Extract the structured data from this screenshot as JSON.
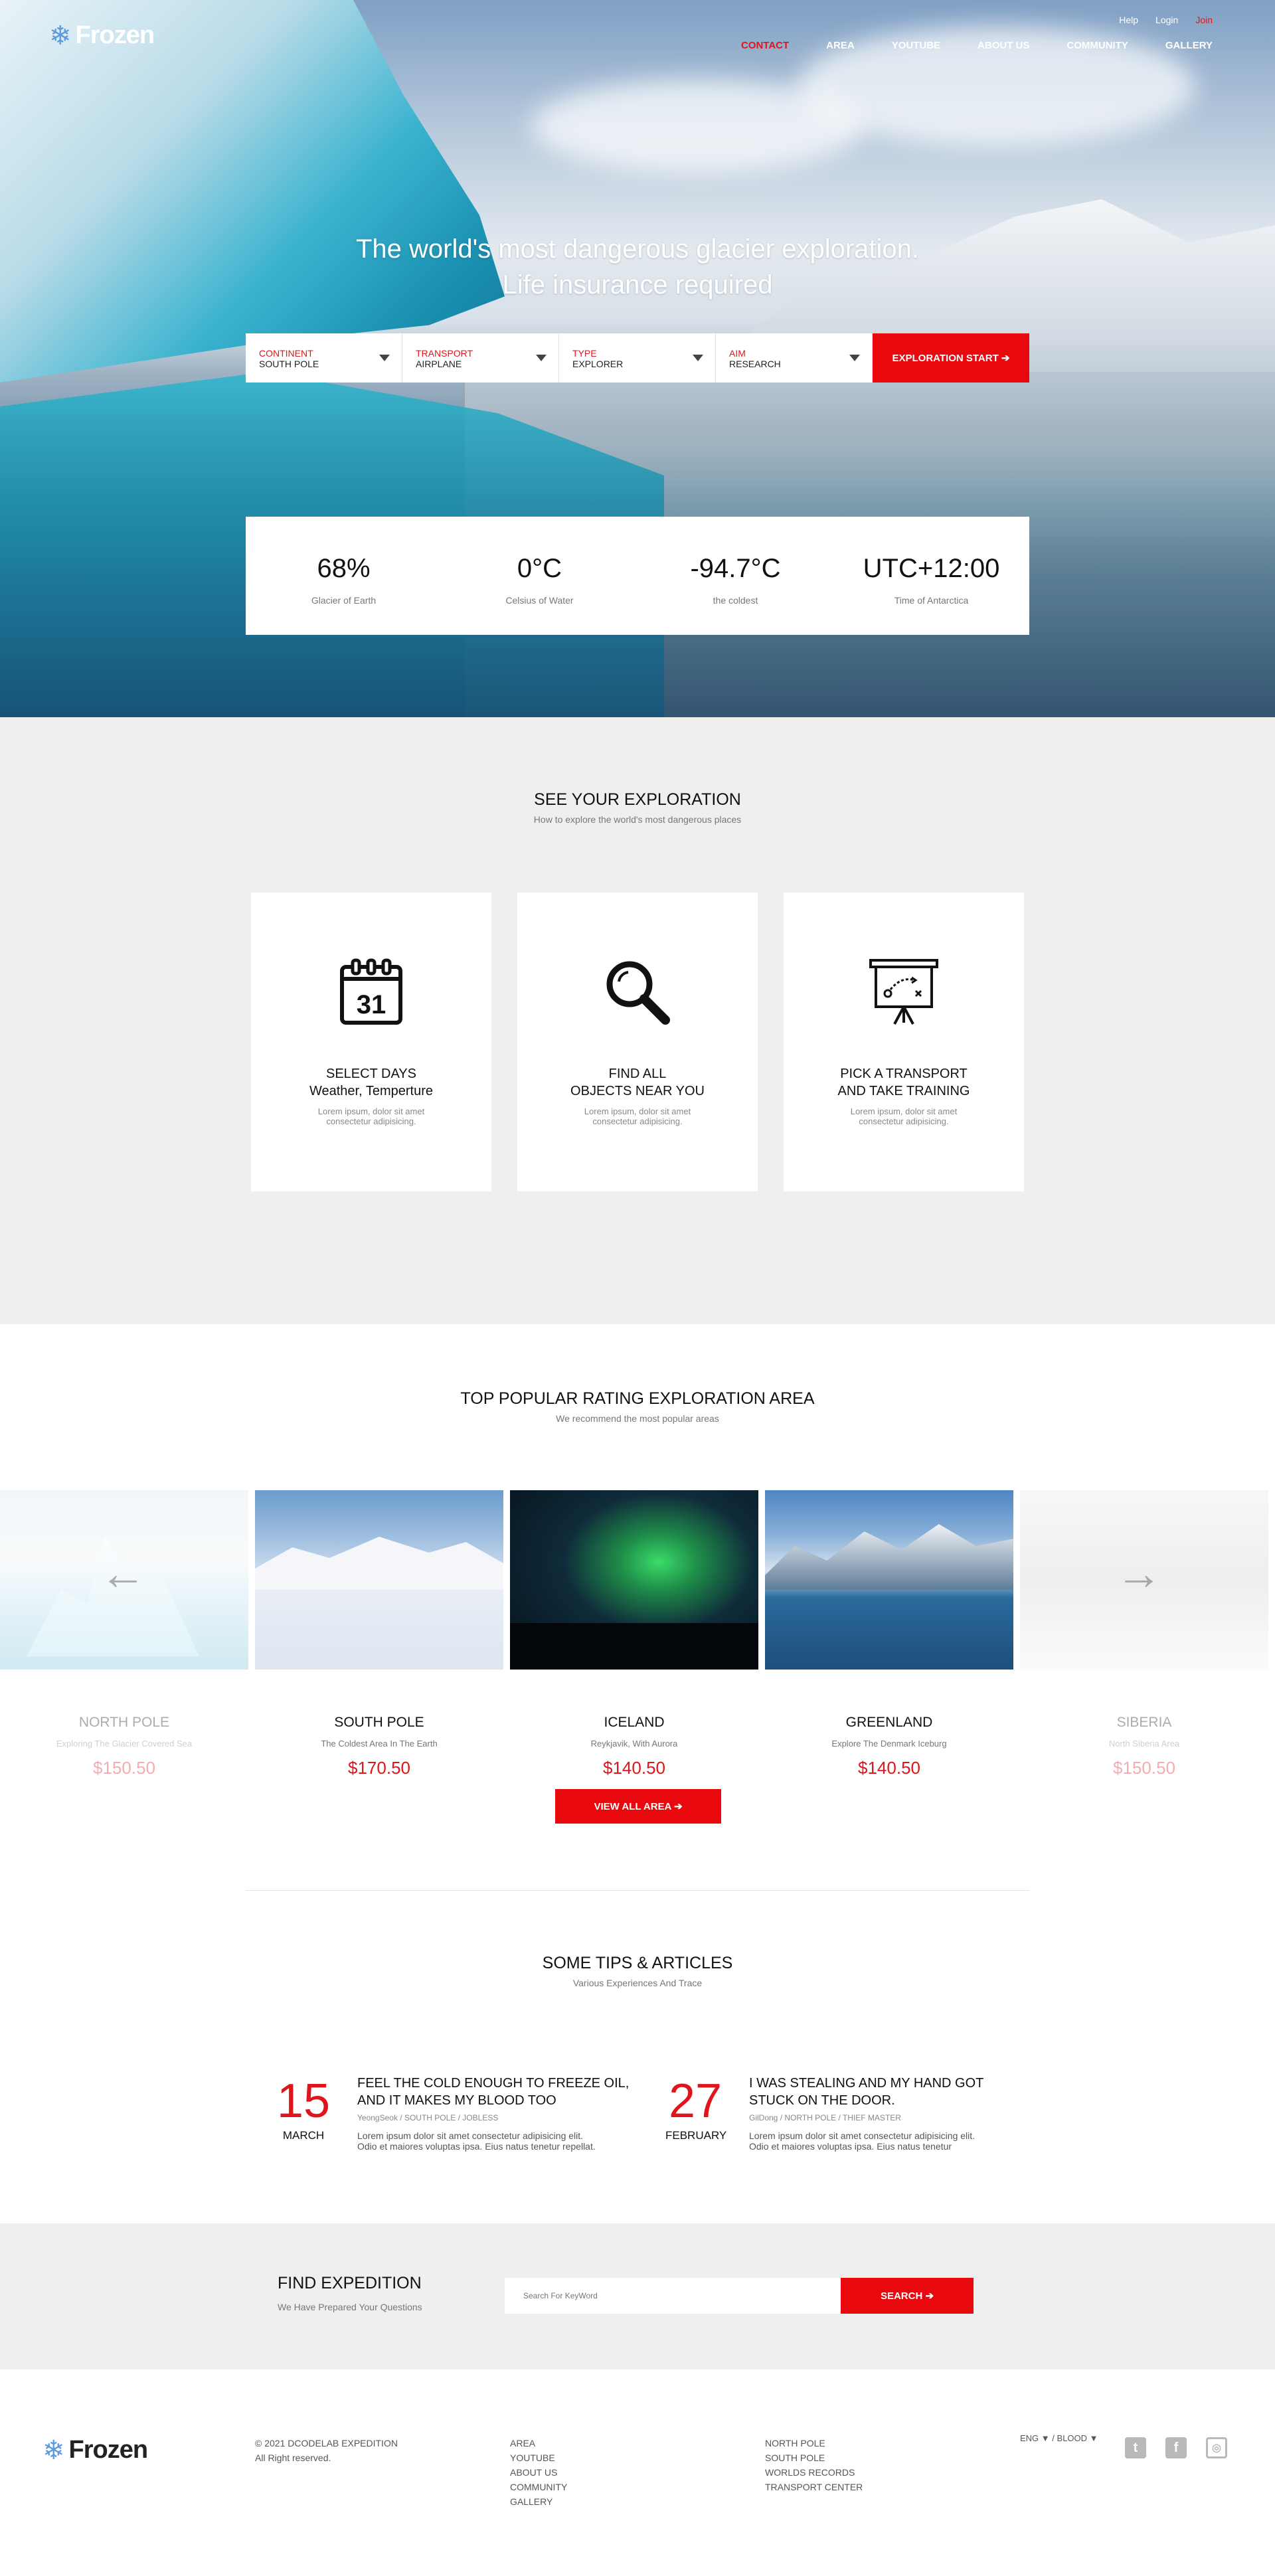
{
  "brand": {
    "name": "Frozen"
  },
  "header": {
    "top_links": [
      "Help",
      "Login",
      "Join"
    ],
    "nav": [
      "CONTACT",
      "AREA",
      "YOUTUBE",
      "ABOUT US",
      "COMMUNITY",
      "GALLERY"
    ]
  },
  "hero": {
    "title_line1": "The world's most dangerous glacier exploration.",
    "title_line2": "Life insurance required",
    "search": {
      "fields": [
        {
          "label": "CONTINENT",
          "value": "SOUTH POLE"
        },
        {
          "label": "TRANSPORT",
          "value": "AIRPLANE"
        },
        {
          "label": "TYPE",
          "value": "EXPLORER"
        },
        {
          "label": "AIM",
          "value": "RESEARCH"
        }
      ],
      "button": "EXPLORATION START ➔"
    },
    "stats": [
      {
        "value": "68%",
        "caption": "Glacier of Earth"
      },
      {
        "value": "0°C",
        "caption": "Celsius of Water"
      },
      {
        "value": "-94.7°C",
        "caption": "the coldest"
      },
      {
        "value": "UTC+12:00",
        "caption": "Time of Antarctica"
      }
    ]
  },
  "explore": {
    "title": "SEE YOUR EXPLORATION",
    "subtitle": "How to explore the world's most dangerous places",
    "cards": [
      {
        "icon": "calendar-icon",
        "line1": "SELECT DAYS",
        "line2": "Weather, Temperture",
        "desc1": "Lorem ipsum, dolor sit amet",
        "desc2": "consectetur adipisicing."
      },
      {
        "icon": "magnifier-icon",
        "line1": "FIND ALL",
        "line2": "OBJECTS NEAR YOU",
        "desc1": "Lorem ipsum, dolor sit amet",
        "desc2": "consectetur adipisicing."
      },
      {
        "icon": "presentation-board-icon",
        "line1": "PICK A TRANSPORT",
        "line2": "AND TAKE TRAINING",
        "desc1": "Lorem ipsum, dolor sit amet",
        "desc2": "consectetur adipisicing."
      }
    ]
  },
  "areas": {
    "title": "TOP POPULAR RATING EXPLORATION AREA",
    "subtitle": "We recommend the most popular areas",
    "items": [
      {
        "name": "NORTH POLE",
        "desc": "Exploring The Glacier Covered Sea",
        "price": "$150.50"
      },
      {
        "name": "SOUTH POLE",
        "desc": "The Coldest Area In The Earth",
        "price": "$170.50"
      },
      {
        "name": "ICELAND",
        "desc": "Reykjavik, With Aurora",
        "price": "$140.50"
      },
      {
        "name": "GREENLAND",
        "desc": "Explore The Denmark Iceburg",
        "price": "$140.50"
      },
      {
        "name": "SIBERIA",
        "desc": "North Siberia Area",
        "price": "$150.50"
      }
    ],
    "view_all": "VIEW ALL AREA ➔"
  },
  "articles": {
    "title": "SOME TIPS & ARTICLES",
    "subtitle": "Various Experiences And Trace",
    "items": [
      {
        "day": "15",
        "month": "MARCH",
        "title1": "FEEL THE COLD ENOUGH TO FREEZE OIL,",
        "title2": "AND IT MAKES MY BLOOD TOO",
        "meta": "YeongSeok / SOUTH POLE / JOBLESS",
        "body1": "Lorem ipsum dolor sit amet consectetur adipisicing elit.",
        "body2": "Odio et maiores voluptas ipsa. Eius natus tenetur repellat."
      },
      {
        "day": "27",
        "month": "FEBRUARY",
        "title1": "I WAS STEALING AND MY HAND GOT",
        "title2": "STUCK ON THE DOOR.",
        "meta": "GilDong / NORTH POLE / THIEF MASTER",
        "body1": "Lorem ipsum dolor sit amet consectetur adipisicing elit.",
        "body2": "Odio et maiores voluptas ipsa. Eius natus tenetur"
      }
    ]
  },
  "find": {
    "title": "FIND EXPEDITION",
    "subtitle": "We Have Prepared Your Questions",
    "placeholder": "Search For KeyWord",
    "button": "SEARCH ➔"
  },
  "footer": {
    "copyright1": "© 2021 DCODELAB EXPEDITION",
    "copyright2": "All Right reserved.",
    "col1": [
      "AREA",
      "YOUTUBE",
      "ABOUT US",
      "COMMUNITY",
      "GALLERY"
    ],
    "col2": [
      "NORTH POLE",
      "SOUTH POLE",
      "WORLDS RECORDS",
      "TRANSPORT CENTER"
    ],
    "lang": "ENG",
    "theme": "BLOOD",
    "social": [
      "twitter-icon",
      "facebook-icon",
      "instagram-icon"
    ]
  }
}
